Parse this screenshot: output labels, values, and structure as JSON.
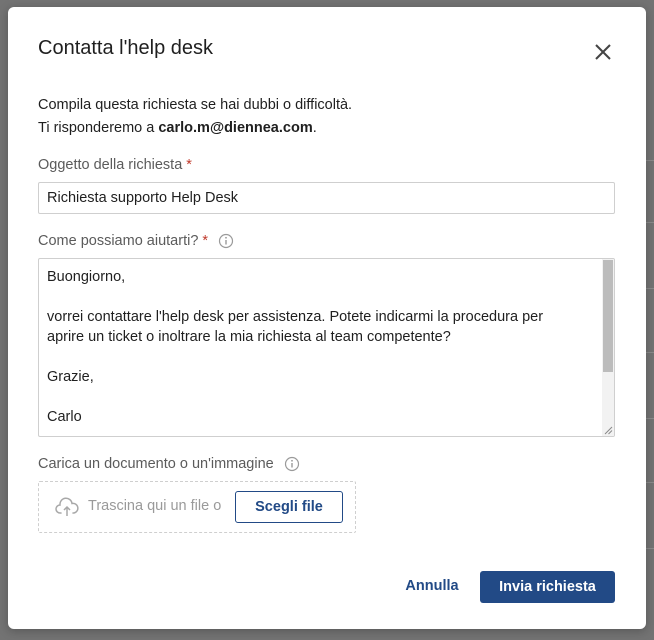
{
  "dialog": {
    "title": "Contatta l'help desk",
    "close_icon": "close-icon",
    "intro_line1": "Compila questa richiesta se hai dubbi o difficoltà.",
    "intro_line2_prefix": "Ti risponderemo a ",
    "email": "carlo.m@diennea.com",
    "intro_line2_suffix": "."
  },
  "form": {
    "subject": {
      "label": "Oggetto della richiesta",
      "required_mark": "*",
      "value": "Richiesta supporto Help Desk"
    },
    "message": {
      "label": "Come possiamo aiutarti?",
      "required_mark": "*",
      "info_icon": "info-icon",
      "lines": {
        "l1": "Buongiorno,",
        "l2": "vorrei contattare l'help desk per assistenza. Potete indicarmi la procedura per",
        "l3": "aprire un ticket o inoltrare la mia richiesta al team competente?",
        "l4": "Grazie,",
        "l5": "Carlo"
      }
    },
    "attachment": {
      "label": "Carica un documento o un'immagine",
      "info_icon": "info-icon",
      "upload_icon": "cloud-upload-icon",
      "drop_text": "Trascina qui un file o",
      "choose_label": "Scegli file"
    }
  },
  "actions": {
    "cancel_label": "Annulla",
    "submit_label": "Invia richiesta"
  },
  "colors": {
    "accent": "#224a86",
    "required": "#c0392b"
  }
}
